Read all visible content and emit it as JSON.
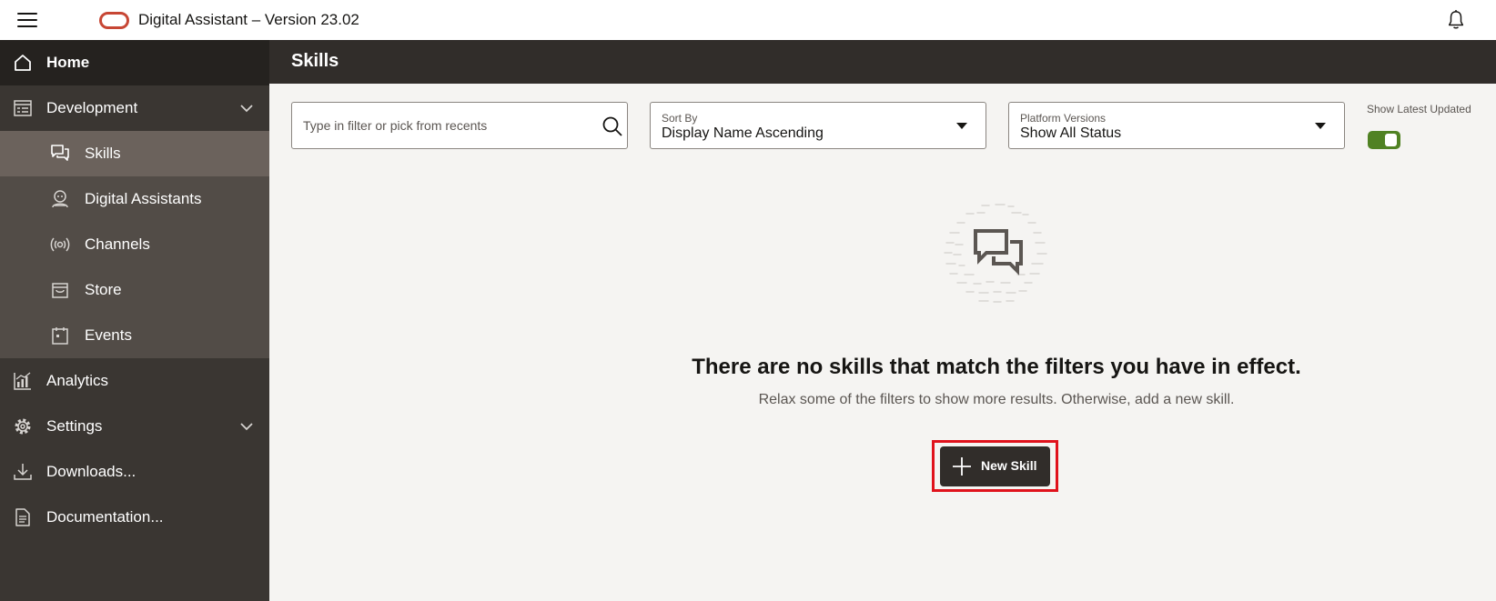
{
  "app": {
    "title": "Digital Assistant – Version 23.02",
    "logo_color": "#c74634"
  },
  "header_icons": {
    "menu": "hamburger-menu-icon",
    "notifications": "bell-icon"
  },
  "sidebar": {
    "home": {
      "label": "Home",
      "icon": "home-icon"
    },
    "development": {
      "label": "Development",
      "icon": "development-icon",
      "expanded": true,
      "items": [
        {
          "label": "Skills",
          "icon": "skills-chat-icon",
          "active": true
        },
        {
          "label": "Digital Assistants",
          "icon": "digital-assistant-icon"
        },
        {
          "label": "Channels",
          "icon": "channels-broadcast-icon"
        },
        {
          "label": "Store",
          "icon": "store-bag-icon"
        },
        {
          "label": "Events",
          "icon": "events-calendar-icon"
        }
      ]
    },
    "analytics": {
      "label": "Analytics",
      "icon": "analytics-chart-icon"
    },
    "settings": {
      "label": "Settings",
      "icon": "settings-gear-icon",
      "expanded": false
    },
    "downloads": {
      "label": "Downloads...",
      "icon": "download-icon"
    },
    "documentation": {
      "label": "Documentation...",
      "icon": "documentation-icon"
    }
  },
  "page": {
    "title": "Skills"
  },
  "filters": {
    "search": {
      "placeholder": "Type in filter or pick from recents",
      "value": ""
    },
    "sort": {
      "label": "Sort By",
      "value": "Display Name Ascending"
    },
    "platform": {
      "label": "Platform Versions",
      "value": "Show All Status"
    },
    "latest_toggle": {
      "label": "Show Latest Updated",
      "on": true,
      "color": "#508223"
    }
  },
  "empty_state": {
    "title": "There are no skills that match the filters you have in effect.",
    "subtitle": "Relax some of the filters to show more results. Otherwise, add a new skill.",
    "button_label": "New Skill",
    "highlight_color": "#e0121c"
  }
}
